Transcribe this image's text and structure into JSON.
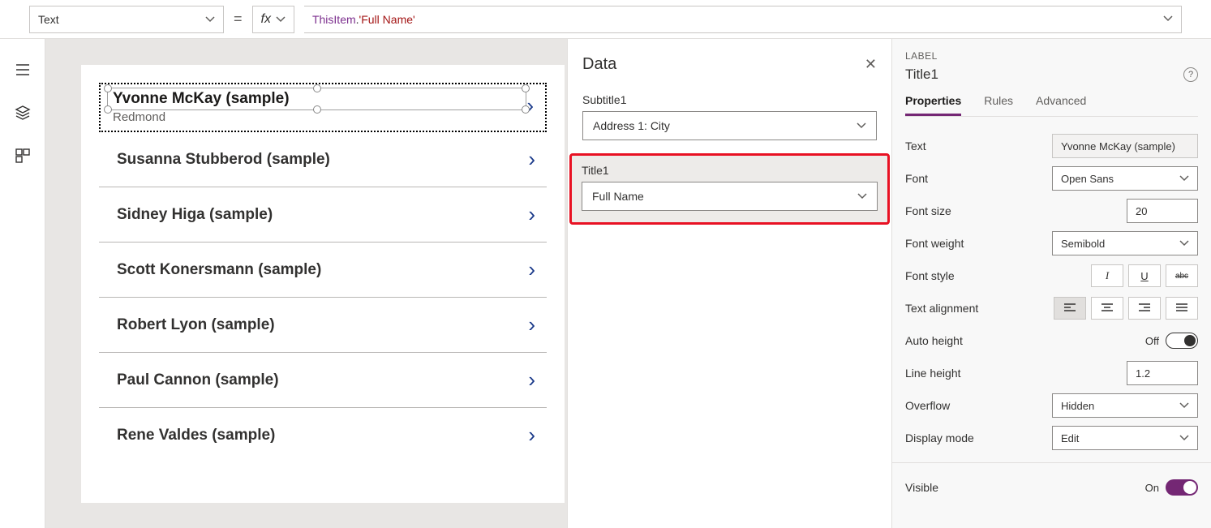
{
  "formulaBar": {
    "property": "Text",
    "fxLabel": "fx",
    "expr_obj": "ThisItem",
    "expr_dot": ".",
    "expr_lit": "'Full Name'"
  },
  "gallery": {
    "selected": {
      "title": "Yvonne McKay (sample)",
      "subtitle": "Redmond"
    },
    "rows": [
      "Susanna Stubberod (sample)",
      "Sidney Higa (sample)",
      "Scott Konersmann (sample)",
      "Robert Lyon (sample)",
      "Paul Cannon (sample)",
      "Rene Valdes (sample)"
    ]
  },
  "dataPane": {
    "title": "Data",
    "fields": {
      "subtitle_label": "Subtitle1",
      "subtitle_value": "Address 1: City",
      "title_label": "Title1",
      "title_value": "Full Name"
    }
  },
  "propsPane": {
    "typeLabel": "LABEL",
    "name": "Title1",
    "tabs": {
      "properties": "Properties",
      "rules": "Rules",
      "advanced": "Advanced"
    },
    "rows": {
      "text_label": "Text",
      "text_value": "Yvonne McKay (sample)",
      "font_label": "Font",
      "font_value": "Open Sans",
      "fontsize_label": "Font size",
      "fontsize_value": "20",
      "fontweight_label": "Font weight",
      "fontweight_value": "Semibold",
      "fontstyle_label": "Font style",
      "align_label": "Text alignment",
      "autoheight_label": "Auto height",
      "autoheight_value": "Off",
      "lineheight_label": "Line height",
      "lineheight_value": "1.2",
      "overflow_label": "Overflow",
      "overflow_value": "Hidden",
      "display_label": "Display mode",
      "display_value": "Edit",
      "visible_label": "Visible",
      "visible_value": "On"
    },
    "styleGlyphs": {
      "italic": "I",
      "underline": "U",
      "strike": "abc"
    }
  }
}
